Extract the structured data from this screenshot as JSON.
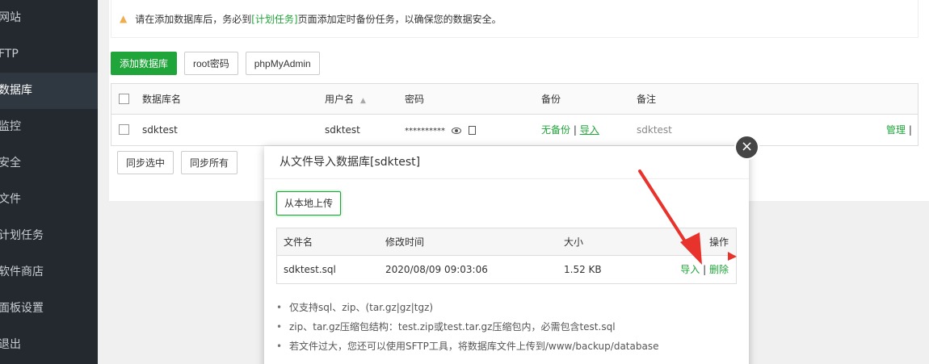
{
  "sidebar": {
    "items": [
      {
        "label": "网站",
        "active": false
      },
      {
        "label": "FTP",
        "active": false
      },
      {
        "label": "数据库",
        "active": true
      },
      {
        "label": "监控",
        "active": false
      },
      {
        "label": "安全",
        "active": false
      },
      {
        "label": "文件",
        "active": false
      },
      {
        "label": "计划任务",
        "active": false
      },
      {
        "label": "软件商店",
        "active": false
      },
      {
        "label": "面板设置",
        "active": false
      },
      {
        "label": "退出",
        "active": false
      }
    ]
  },
  "notice": {
    "before": "请在添加数据库后，务必到",
    "link": "[计划任务]",
    "after": "页面添加定时备份任务，以确保您的数据安全。"
  },
  "toolbar": {
    "add_db": "添加数据库",
    "root_pwd": "root密码",
    "phpmyadmin": "phpMyAdmin"
  },
  "db_table": {
    "headers": {
      "name": "数据库名",
      "user": "用户名",
      "password": "密码",
      "backup": "备份",
      "note": "备注"
    },
    "row": {
      "name": "sdktest",
      "user": "sdktest",
      "password": "**********",
      "backup_status": "无备份",
      "backup_sep": " | ",
      "import": "导入",
      "note": "sdktest",
      "manage": "管理",
      "manage_sep": " | "
    }
  },
  "sync": {
    "selected": "同步选中",
    "all": "同步所有"
  },
  "modal": {
    "title": "从文件导入数据库[sdktest]",
    "upload_label": "从本地上传",
    "headers": {
      "filename": "文件名",
      "mtime": "修改时间",
      "size": "大小",
      "ops": "操作"
    },
    "file": {
      "filename": "sdktest.sql",
      "mtime": "2020/08/09 09:03:06",
      "size": "1.52 KB",
      "import": "导入",
      "sep": " | ",
      "delete": "删除"
    },
    "tips": [
      "仅支持sql、zip、(tar.gz|gz|tgz)",
      "zip、tar.gz压缩包结构：test.zip或test.tar.gz压缩包内，必需包含test.sql",
      "若文件过大，您还可以使用SFTP工具，将数据库文件上传到/www/backup/database"
    ]
  },
  "colors": {
    "brand_green": "#20a53a",
    "sidebar_bg": "#23292f",
    "arrow_red": "#e8322c"
  }
}
